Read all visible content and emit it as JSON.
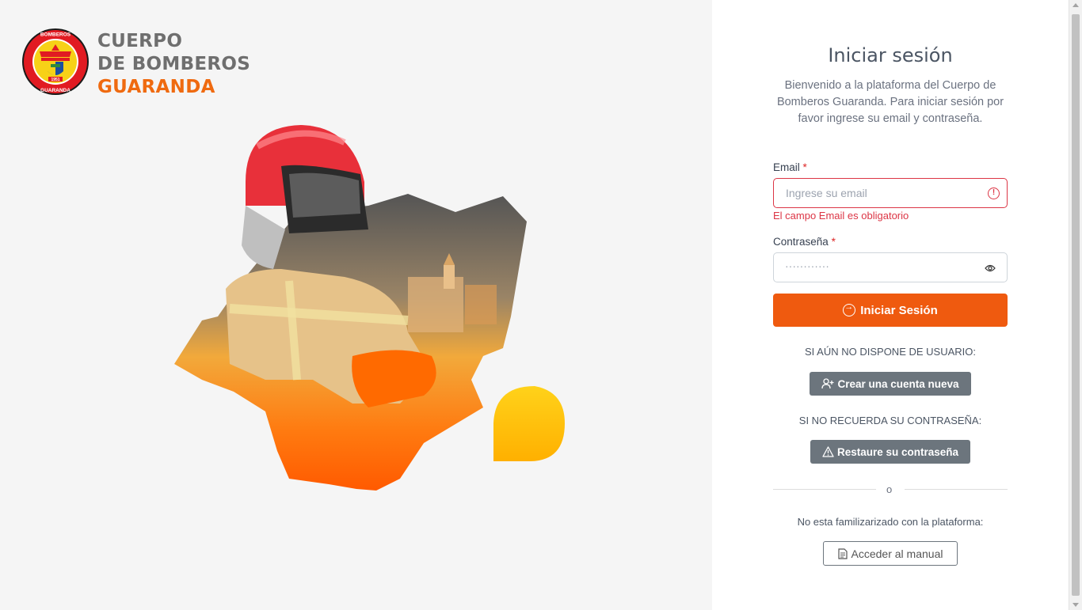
{
  "brand": {
    "line1": "CUERPO",
    "line2": "DE BOMBEROS",
    "line3": "GUARANDA",
    "seal_top": "BOMBEROS",
    "seal_bottom": "GUARANDA",
    "seal_year": "1951",
    "accent_color": "#ef6a10",
    "gray_color": "#6f6f6f"
  },
  "login": {
    "title": "Iniciar sesión",
    "intro": "Bienvenido a la plataforma del Cuerpo de Bomberos Guaranda. Para iniciar sesión por favor ingrese su email y contraseña.",
    "email_label": "Email",
    "required_mark": "*",
    "email_placeholder": "Ingrese su email",
    "email_error": "El campo Email es obligatorio",
    "password_label": "Contraseña",
    "password_placeholder": "············",
    "submit_label": "Iniciar Sesión",
    "no_user_caption": "SI AÚN NO DISPONE DE USUARIO:",
    "create_account_label": "Crear una cuenta nueva",
    "forgot_caption": "SI NO RECUERDA SU CONTRASEÑA:",
    "restore_label": "Restaure su contraseña",
    "divider_text": "o",
    "manual_caption": "No esta familizarizado con la plataforma:",
    "manual_label": "Acceder al manual"
  },
  "colors": {
    "primary_button": "#ef5a0f",
    "secondary_button": "#6c757d",
    "error": "#dc3545"
  },
  "icons": {
    "email_error": "exclamation-circle-icon",
    "password_toggle": "eye-icon",
    "submit": "arrow-right-circle-icon",
    "create_account": "person-plus-icon",
    "restore": "warning-triangle-icon",
    "manual": "document-icon"
  }
}
